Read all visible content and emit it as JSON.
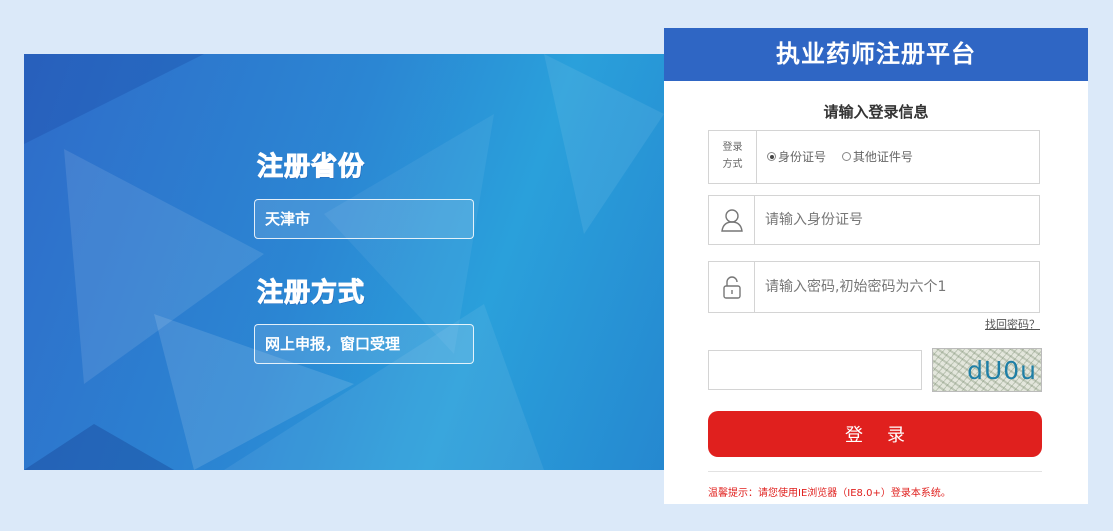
{
  "banner": {
    "province_heading": "注册省份",
    "province_value": "天津市",
    "method_heading": "注册方式",
    "method_value": "网上申报，窗口受理"
  },
  "login": {
    "title": "执业药师注册平台",
    "subtitle": "请输入登录信息",
    "method_label_line1": "登录",
    "method_label_line2": "方式",
    "method_options": [
      "身份证号",
      "其他证件号"
    ],
    "method_selected": "身份证号",
    "id_placeholder": "请输入身份证号",
    "password_placeholder": "请输入密码,初始密码为六个1",
    "forgot_label": "找回密码？",
    "captcha_value": "",
    "captcha_text": "dU0u",
    "submit_label": "登录",
    "tip": "温馨提示：请您使用IE浏览器（IE8.0+）登录本系统。"
  },
  "colors": {
    "page_bg": "#dbe9f9",
    "header_blue": "#2f66c4",
    "button_red": "#e0201e"
  },
  "icons": [
    "user-icon",
    "lock-icon"
  ]
}
